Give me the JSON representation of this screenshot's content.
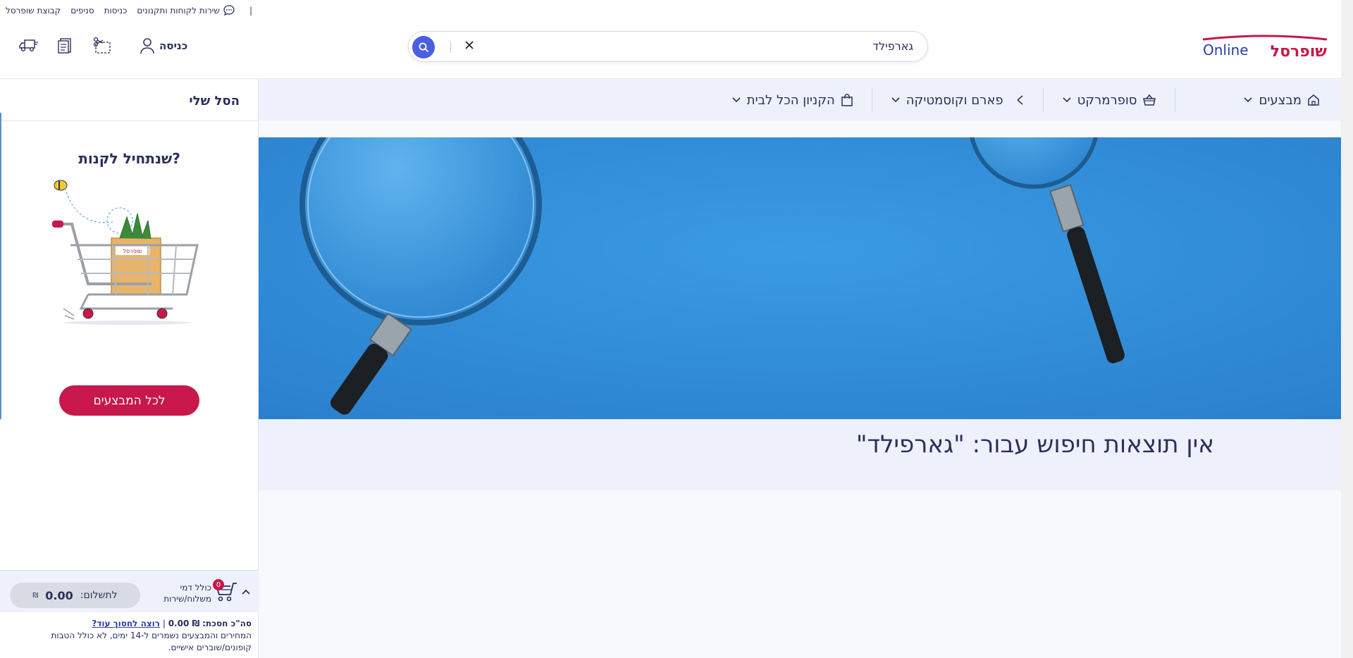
{
  "utility_bar": {
    "group_label": "קבוצת שופרסל",
    "coupons_label": "סניפים",
    "entrance_label": "כניסות",
    "service_label": "שירות לקוחות ותקנונים",
    "separator": "|"
  },
  "header": {
    "logo_text": "שופרסל",
    "logo_online": "Online",
    "search": {
      "value": "גארפילד",
      "placeholder": ""
    },
    "login_label": "כניסה"
  },
  "catnav": {
    "items": [
      {
        "label": "מבצעים",
        "icon": "home-icon"
      },
      {
        "label": "סופרמרקט",
        "icon": "basket-icon"
      },
      {
        "label": "פארם וקוסמטיקה",
        "icon": "pharm-icon"
      },
      {
        "label": "הקניון הכל לבית",
        "icon": "bag-icon"
      }
    ]
  },
  "main": {
    "no_results": "אין תוצאות חיפוש עבור: \"גארפילד\""
  },
  "cart": {
    "title": "הסל שלי",
    "start_title": "שנתחיל לקנות?",
    "all_deals_button": "לכל המבצעים",
    "badge_count": "0",
    "shipping_note": "כולל דמי משלוח/שירות",
    "pay_label": "לתשלום:",
    "pay_amount": "0.00",
    "currency": "₪",
    "savings_label": "סה\"כ חסכת:",
    "savings_amount": "₪ 0.00",
    "want_save_link": "רוצה לחסוך עוד?",
    "disclaimer": "המחירים והמבצעים נשמרים ל-14 ימים, לא כולל הטבות קופונים/שוברים אישיים."
  },
  "colors": {
    "brand_red": "#c8174a",
    "accent_blue": "#4a5fe0",
    "navy_text": "#2b2f5a",
    "banner_blue": "#2f8fd9"
  }
}
